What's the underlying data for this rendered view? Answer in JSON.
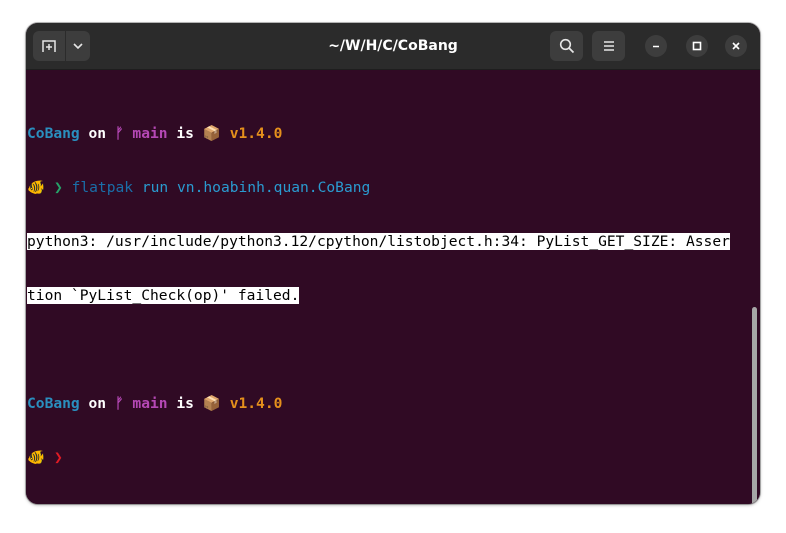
{
  "window": {
    "title": "~/W/H/C/CoBang"
  },
  "header": {
    "new_tab_icon": "new-tab-icon",
    "menu_dropdown_icon": "chevron-down-icon",
    "search_icon": "search-icon",
    "hamburger_icon": "hamburger-menu-icon",
    "minimize_icon": "minimize-icon",
    "maximize_icon": "maximize-icon",
    "close_icon": "close-icon"
  },
  "terminal": {
    "prompt1": {
      "dir": "CoBang",
      "on": " on ",
      "branch_icon": "ᚠ",
      "branch": " main",
      "is": " is ",
      "package_icon": "📦",
      "version": " v1.4.0"
    },
    "command_line": {
      "fish_icon": "🐠",
      "arrow": "❯",
      "cmd": "flatpak",
      "args": " run vn.hoabinh.quan.CoBang"
    },
    "output": [
      "python3: /usr/include/python3.12/cpython/listobject.h:34: PyList_GET_SIZE: Asser",
      "tion `PyList_Check(op)' failed."
    ],
    "prompt2": {
      "dir": "CoBang",
      "on": " on ",
      "branch_icon": "ᚠ",
      "branch": " main",
      "is": " is ",
      "package_icon": "📦",
      "version": " v1.4.0"
    },
    "current_line": {
      "fish_icon": "🐠",
      "arrow": "❯"
    }
  },
  "colors": {
    "terminal_bg": "#300a24",
    "header_bg": "#2b2b2b",
    "dir": "#2a8fbf",
    "branch": "#b548b5",
    "version": "#e5901c",
    "arrow_ok": "#26a269",
    "arrow_err": "#e01b24"
  }
}
